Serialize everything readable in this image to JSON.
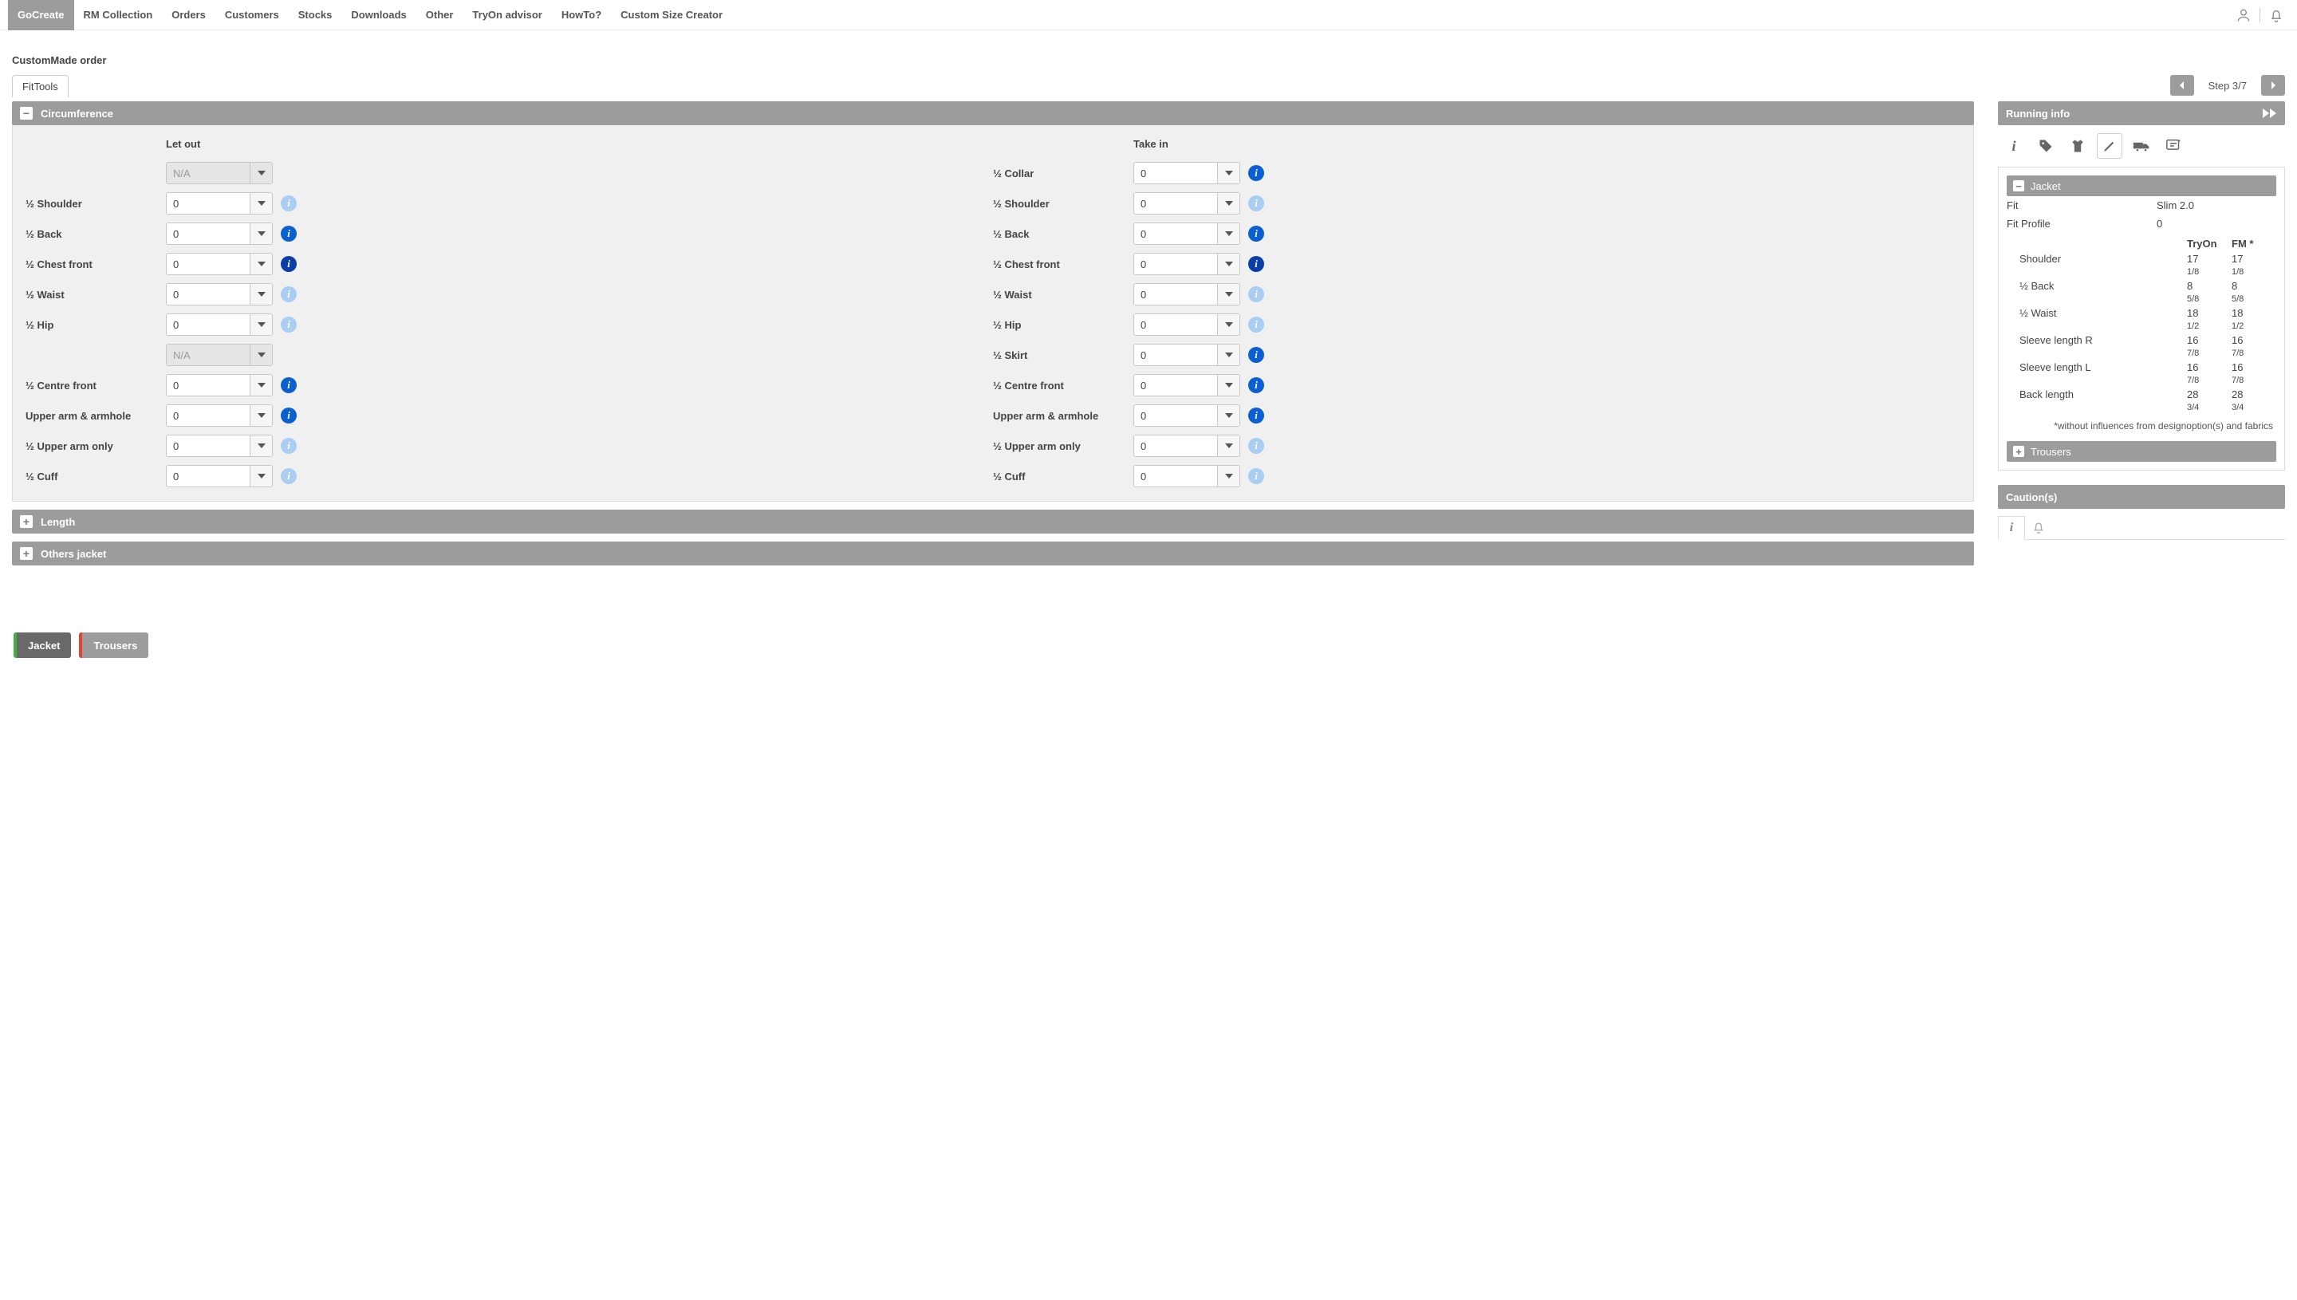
{
  "nav": {
    "items": [
      "GoCreate",
      "RM Collection",
      "Orders",
      "Customers",
      "Stocks",
      "Downloads",
      "Other",
      "TryOn advisor",
      "HowTo?",
      "Custom Size Creator"
    ],
    "activeIndex": 0
  },
  "page_title": "CustomMade order",
  "tab_label": "FitTools",
  "step_text": "Step 3/7",
  "sections": {
    "circumference": "Circumference",
    "length": "Length",
    "others": "Others jacket"
  },
  "col_headers": {
    "letout": "Let out",
    "takein": "Take in"
  },
  "na": "N/A",
  "letout_rows": [
    {
      "label": "",
      "disabled": true
    },
    {
      "label": "½ Shoulder",
      "v": "0",
      "info": "off"
    },
    {
      "label": "½ Back",
      "v": "0",
      "info": "on"
    },
    {
      "label": "½ Chest front",
      "v": "0",
      "info": "strong"
    },
    {
      "label": "½ Waist",
      "v": "0",
      "info": "off"
    },
    {
      "label": "½ Hip",
      "v": "0",
      "info": "off"
    },
    {
      "label": "",
      "disabled": true
    },
    {
      "label": "½ Centre front",
      "v": "0",
      "info": "on"
    },
    {
      "label": "Upper arm & armhole",
      "v": "0",
      "info": "on"
    },
    {
      "label": "½ Upper arm only",
      "v": "0",
      "info": "off"
    },
    {
      "label": "½ Cuff",
      "v": "0",
      "info": "off"
    }
  ],
  "takein_rows": [
    {
      "label": "½ Collar",
      "v": "0",
      "info": "on"
    },
    {
      "label": "½ Shoulder",
      "v": "0",
      "info": "off"
    },
    {
      "label": "½ Back",
      "v": "0",
      "info": "on"
    },
    {
      "label": "½ Chest front",
      "v": "0",
      "info": "strong"
    },
    {
      "label": "½ Waist",
      "v": "0",
      "info": "off"
    },
    {
      "label": "½ Hip",
      "v": "0",
      "info": "off"
    },
    {
      "label": "½ Skirt",
      "v": "0",
      "info": "on"
    },
    {
      "label": "½ Centre front",
      "v": "0",
      "info": "on"
    },
    {
      "label": "Upper arm & armhole",
      "v": "0",
      "info": "on"
    },
    {
      "label": "½ Upper arm only",
      "v": "0",
      "info": "off"
    },
    {
      "label": "½ Cuff",
      "v": "0",
      "info": "off"
    }
  ],
  "footer_tabs": {
    "jacket": "Jacket",
    "trousers": "Trousers"
  },
  "running": {
    "title": "Running info",
    "jacket_h": "Jacket",
    "trousers_h": "Trousers",
    "fit_label": "Fit",
    "fit_value": "Slim 2.0",
    "fitprofile_label": "Fit Profile",
    "fitprofile_value": "0",
    "cols": {
      "tryon": "TryOn",
      "fm": "FM *"
    },
    "measures": [
      {
        "k": "Shoulder",
        "a": "17",
        "af": "1/8",
        "b": "17",
        "bf": "1/8"
      },
      {
        "k": "½ Back",
        "a": "8",
        "af": "5/8",
        "b": "8",
        "bf": "5/8"
      },
      {
        "k": "½ Waist",
        "a": "18",
        "af": "1/2",
        "b": "18",
        "bf": "1/2"
      },
      {
        "k": "Sleeve length R",
        "a": "16",
        "af": "7/8",
        "b": "16",
        "bf": "7/8"
      },
      {
        "k": "Sleeve length L",
        "a": "16",
        "af": "7/8",
        "b": "16",
        "bf": "7/8"
      },
      {
        "k": "Back length",
        "a": "28",
        "af": "3/4",
        "b": "28",
        "bf": "3/4"
      }
    ],
    "footnote": "*without influences from designoption(s) and fabrics"
  },
  "cautions_title": "Caution(s)"
}
